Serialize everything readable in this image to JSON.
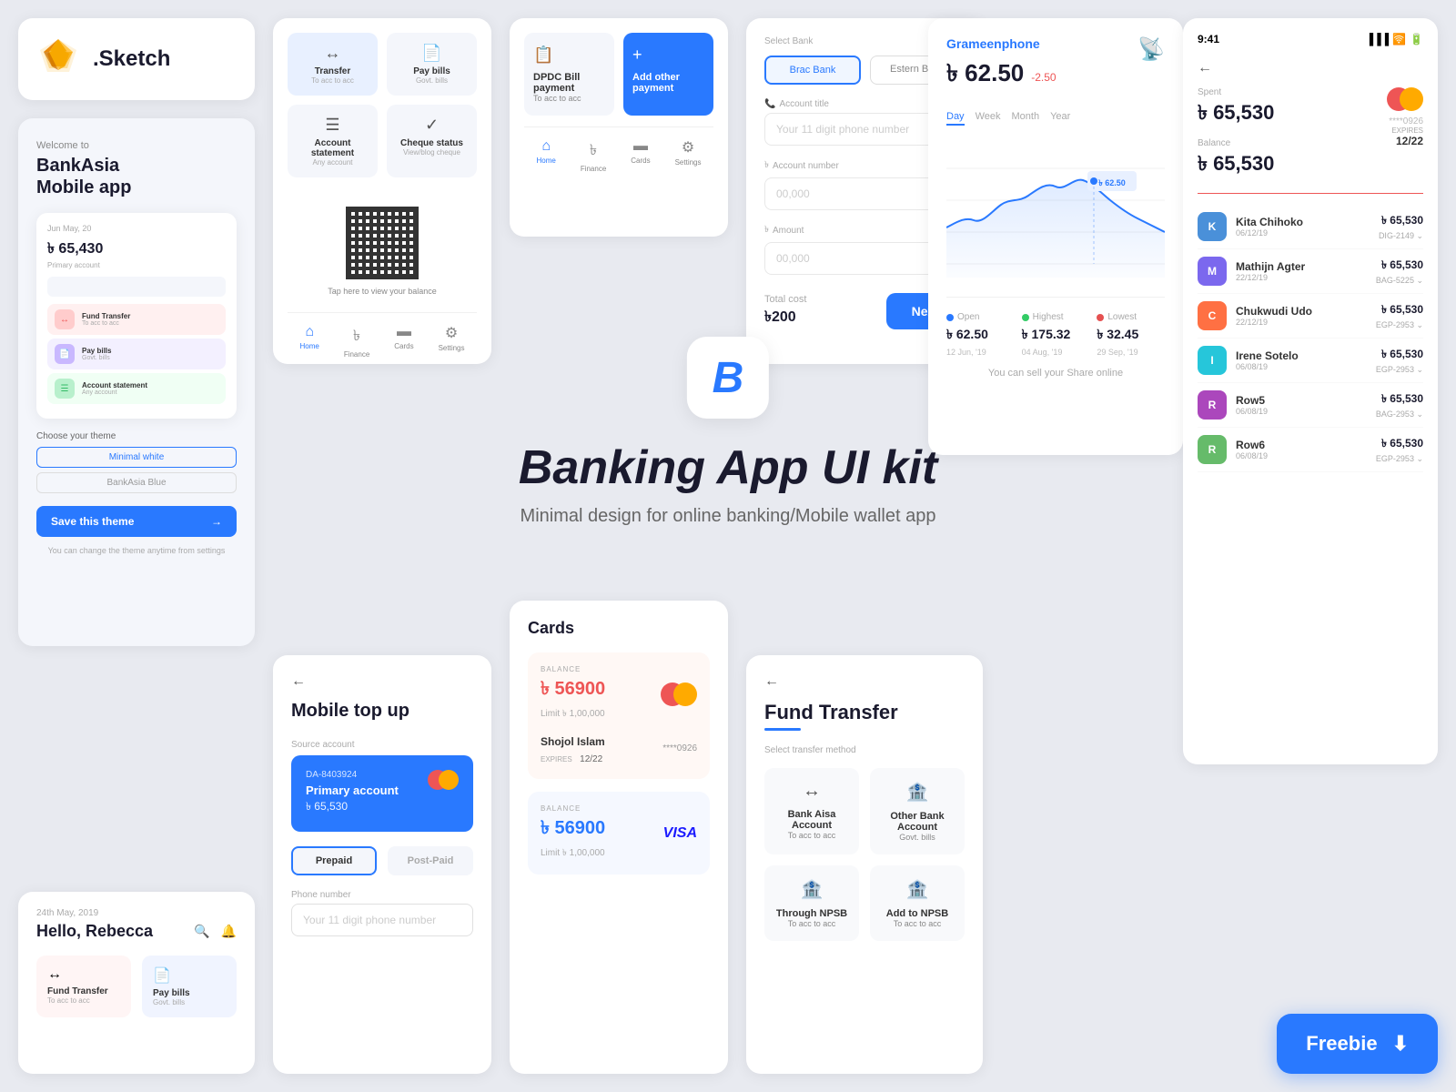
{
  "hero": {
    "logo_letter": "B",
    "title": "Banking App UI kit",
    "subtitle": "Minimal design for online banking/Mobile wallet app"
  },
  "sketch_card": {
    "name": ".Sketch"
  },
  "bankasia": {
    "welcome": "Welcome to",
    "title": "BankAsia\nMobile app",
    "date": "Jun May, 20",
    "balance": "৳ 65,430",
    "balance_label": "Primary account",
    "theme_label": "Choose your theme",
    "theme_1": "Minimal white",
    "theme_2": "BankAsia Blue",
    "save_btn": "Save this theme",
    "note": "You can change the theme anytime from settings",
    "menu_items": [
      {
        "label": "Fund Transfer",
        "sub": "To acc to acc"
      },
      {
        "label": "Pay bills",
        "sub": "Govt. bills"
      },
      {
        "label": "Account statement",
        "sub": "Any account"
      }
    ]
  },
  "hello_card": {
    "date": "24th May, 2019",
    "greeting": "Hello, Rebecca",
    "actions": [
      {
        "label": "Fund Transfer",
        "sub": "To acc to acc"
      },
      {
        "label": "Pay bills",
        "sub": "Govt. bills"
      }
    ]
  },
  "transfer_panel": {
    "items": [
      {
        "label": "Transfer",
        "sub": "To acc to acc"
      },
      {
        "label": "Pay bills",
        "sub": "Govt. bills"
      },
      {
        "label": "Account statement",
        "sub": "Any account"
      },
      {
        "label": "Cheque status",
        "sub": "View/blog cheque"
      }
    ],
    "qr_text": "Tap here to view your balance",
    "nav": [
      "Home",
      "Finance",
      "Cards",
      "Settings"
    ]
  },
  "dpdc": {
    "item1_label": "DPDC Bill payment",
    "item1_sub": "To acc to acc",
    "item2_label": "Add other payment",
    "nav": [
      "Home",
      "Finance",
      "Cards",
      "Settings"
    ]
  },
  "mobile_topup": {
    "title": "Mobile top up",
    "source_label": "Source account",
    "da_number": "DA-8403924",
    "account_name": "Primary account",
    "account_balance": "৳ 65,530",
    "type_prepaid": "Prepaid",
    "type_postpaid": "Post-Paid",
    "phone_label": "Phone number",
    "phone_placeholder": "Your 11 digit phone number"
  },
  "cards_section": {
    "title": "Cards",
    "card1": {
      "balance_label": "BALANCE",
      "balance": "৳ 56900",
      "limit": "Limit    ৳ 1,00,000",
      "number": "****0926",
      "name": "Shojol Islam",
      "expires_label": "EXPIRES",
      "expires": "12/22"
    },
    "card2": {
      "balance_label": "BALANCE",
      "balance": "৳ 56900",
      "limit": "Limit    ৳ 1,00,000"
    }
  },
  "transfer_form": {
    "select_bank_label": "Select Bank",
    "bank1": "Brac Bank",
    "bank2": "Estern Bank",
    "account_title_label": "Account title",
    "account_title_placeholder": "Your 11 digit phone number",
    "account_number_label": "Account number",
    "account_number_placeholder": "00,000",
    "amount_label": "Amount",
    "amount_placeholder": "00,000",
    "total_cost_label": "Total cost",
    "total_cost": "৳200",
    "next_btn": "Next"
  },
  "fund_transfer": {
    "title": "Fund Transfer",
    "select_label": "Select transfer method",
    "methods": [
      {
        "label": "Bank Aisa Account",
        "sub": "To acc to acc"
      },
      {
        "label": "Other Bank Account",
        "sub": "Govt. bills"
      },
      {
        "label": "Through NPSB",
        "sub": "To acc to acc"
      },
      {
        "label": "Add to NPSB",
        "sub": "To acc to acc"
      }
    ]
  },
  "stock": {
    "company": "Grameenphone",
    "price": "৳ 62.50",
    "change": "-2.50",
    "periods": [
      "Day",
      "Week",
      "Month",
      "Year"
    ],
    "active_period": "Day",
    "stats": [
      {
        "type": "Open",
        "value": "৳ 62.50",
        "date": "12 Jun, '19",
        "color": "#2979ff"
      },
      {
        "type": "Highest",
        "value": "৳ 175.32",
        "date": "04 Aug, '19",
        "color": "#33cc66"
      },
      {
        "type": "Lowest",
        "value": "৳ 32.45",
        "date": "29 Sep, '19",
        "color": "#e55050"
      }
    ],
    "sell_note": "You can sell your Share online"
  },
  "transactions": {
    "time": "9:41",
    "spent_label": "Spent",
    "spent": "৳ 65,530",
    "balance_label": "Balance",
    "balance": "৳ 65,530",
    "card_number": "****0926",
    "expires_label": "EXPIRES",
    "expires": "12/22",
    "items": [
      {
        "name": "Kita Chihoko",
        "date": "06/12/19",
        "amount": "৳ 65,530",
        "id": "DIG-2149",
        "color": "#4a90d9"
      },
      {
        "name": "Mathijn Agter",
        "date": "22/12/19",
        "amount": "৳ 65,530",
        "id": "BAG-5225",
        "color": "#7b68ee"
      },
      {
        "name": "Chukwudi Udo",
        "date": "22/12/19",
        "amount": "৳ 65,530",
        "id": "EGP-2953",
        "color": "#ff7043"
      },
      {
        "name": "Irene Sotelo",
        "date": "06/08/19",
        "amount": "৳ 65,530",
        "id": "EGP-2953",
        "color": "#26c6da"
      },
      {
        "name": "Row5",
        "date": "06/08/19",
        "amount": "৳ 65,530",
        "id": "BAG-2953",
        "color": "#ab47bc"
      },
      {
        "name": "Row6",
        "date": "06/08/19",
        "amount": "৳ 65,530",
        "id": "EGP-2953",
        "color": "#66bb6a"
      }
    ]
  },
  "freebie": {
    "label": "Freebie"
  }
}
